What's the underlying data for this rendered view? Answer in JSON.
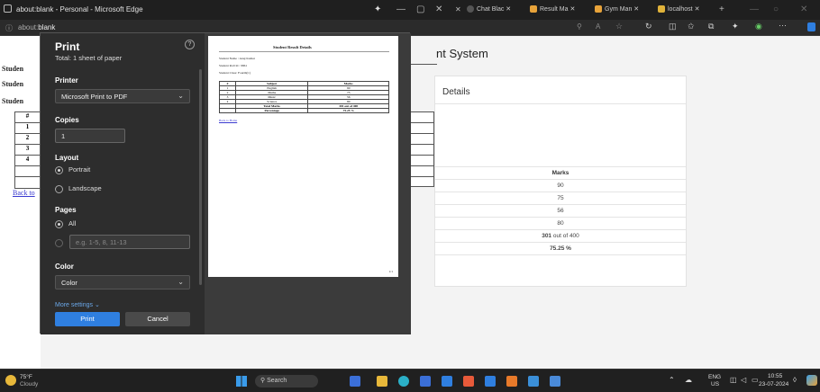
{
  "window": {
    "title": "about:blank - Personal - Microsoft Edge",
    "tabs": [
      {
        "label": "Chat Blac",
        "color": "#555555"
      },
      {
        "label": "Result Ma",
        "color": "#e8a33a"
      },
      {
        "label": "Gym Man",
        "color": "#e8a33a"
      },
      {
        "label": "localhost",
        "color": "#e0b23a"
      }
    ]
  },
  "address_bar": {
    "prefix": "about:",
    "value": "blank"
  },
  "background_page": {
    "labels": [
      "Studen",
      "Studen",
      "Studen"
    ],
    "row_numbers": [
      "#",
      "1",
      "2",
      "3",
      "4"
    ],
    "back_link": "Back to",
    "system_title": "nt System",
    "card_header": "Details",
    "marks_header": "Marks",
    "marks": [
      "90",
      "75",
      "56",
      "80"
    ],
    "total_value": "301",
    "total_suffix": "out of 400",
    "percentage": "75.25 %"
  },
  "print_dialog": {
    "title": "Print",
    "subtitle": "Total: 1 sheet of paper",
    "help": "?",
    "printer_label": "Printer",
    "printer_value": "Microsoft Print to PDF",
    "copies_label": "Copies",
    "copies_value": "1",
    "layout_label": "Layout",
    "layout_portrait": "Portrait",
    "layout_landscape": "Landscape",
    "pages_label": "Pages",
    "pages_all": "All",
    "pages_placeholder": "e.g. 1-5, 8, 11-13",
    "color_label": "Color",
    "color_value": "Color",
    "more_settings": "More settings ⌄",
    "print_button": "Print",
    "cancel_button": "Cancel"
  },
  "preview": {
    "heading": "Student Result Details",
    "name_line": "Student Name : Anuj Kumar",
    "roll_line": "Student Roll Id : 9861",
    "class_line": "Student Class: Fourth(C)",
    "col_num": "#",
    "col_subject": "Subject",
    "col_marks": "Marks",
    "rows": [
      {
        "n": "1",
        "subject": "English",
        "marks": "90"
      },
      {
        "n": "2",
        "subject": "Maths",
        "marks": "75"
      },
      {
        "n": "3",
        "subject": "Music",
        "marks": "56"
      },
      {
        "n": "4",
        "subject": "Science",
        "marks": "80"
      }
    ],
    "total_label": "Total Marks",
    "total_value": "301 out of 400",
    "percent_label": "Percentage",
    "percent_value": "75.25 %",
    "back_link": "Back to Home",
    "footer_right": "1/1"
  },
  "taskbar": {
    "weather_temp": "75°F",
    "weather_desc": "Cloudy",
    "search": "Search",
    "lang_top": "ENG",
    "lang_bottom": "US",
    "time": "10:55",
    "date": "23-07-2024"
  }
}
